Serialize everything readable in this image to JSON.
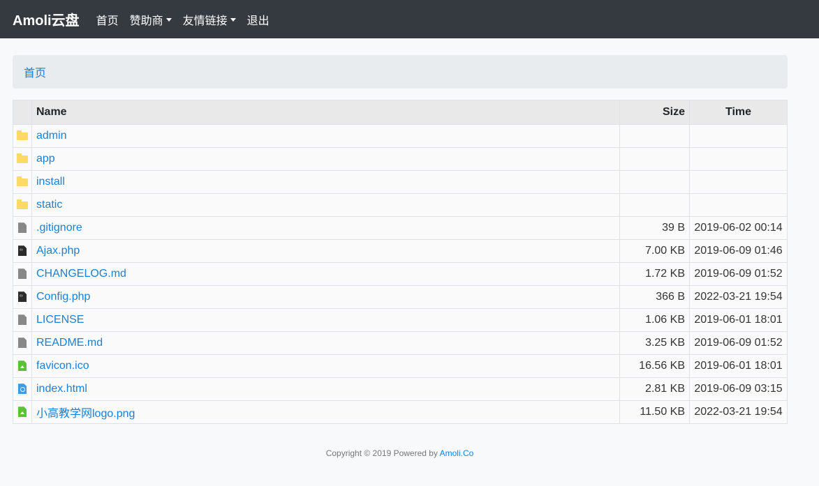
{
  "navbar": {
    "brand": "Amoli云盘",
    "items": [
      {
        "label": "首页",
        "dropdown": false
      },
      {
        "label": "赞助商",
        "dropdown": true
      },
      {
        "label": "友情链接",
        "dropdown": true
      },
      {
        "label": "退出",
        "dropdown": false
      }
    ]
  },
  "breadcrumb": {
    "home": "首页"
  },
  "table": {
    "headers": {
      "name": "Name",
      "size": "Size",
      "time": "Time"
    },
    "rows": [
      {
        "icon": "folder-icon",
        "name": "admin",
        "size": "",
        "time": ""
      },
      {
        "icon": "folder-icon",
        "name": "app",
        "size": "",
        "time": ""
      },
      {
        "icon": "folder-icon",
        "name": "install",
        "size": "",
        "time": ""
      },
      {
        "icon": "folder-icon",
        "name": "static",
        "size": "",
        "time": ""
      },
      {
        "icon": "file-icon",
        "name": ".gitignore",
        "size": "39 B",
        "time": "2019-06-02 00:14"
      },
      {
        "icon": "code-file-icon",
        "name": "Ajax.php",
        "size": "7.00 KB",
        "time": "2019-06-09 01:46"
      },
      {
        "icon": "file-icon",
        "name": "CHANGELOG.md",
        "size": "1.72 KB",
        "time": "2019-06-09 01:52"
      },
      {
        "icon": "code-file-icon",
        "name": "Config.php",
        "size": "366 B",
        "time": "2022-03-21 19:54"
      },
      {
        "icon": "file-icon",
        "name": "LICENSE",
        "size": "1.06 KB",
        "time": "2019-06-01 18:01"
      },
      {
        "icon": "file-icon",
        "name": "README.md",
        "size": "3.25 KB",
        "time": "2019-06-09 01:52"
      },
      {
        "icon": "image-file-icon",
        "name": "favicon.ico",
        "size": "16.56 KB",
        "time": "2019-06-01 18:01"
      },
      {
        "icon": "html-file-icon",
        "name": "index.html",
        "size": "2.81 KB",
        "time": "2019-06-09 03:15"
      },
      {
        "icon": "image-file-icon",
        "name": "小高教学网logo.png",
        "size": "11.50 KB",
        "time": "2022-03-21 19:54"
      }
    ]
  },
  "footer": {
    "text": "Copyright © 2019 Powered by ",
    "link": "Amoli.Co"
  },
  "colors": {
    "navbar_bg": "#343a40",
    "link": "#1a7fd6",
    "breadcrumb_bg": "#e9ecef",
    "folder": "#ffd966"
  }
}
